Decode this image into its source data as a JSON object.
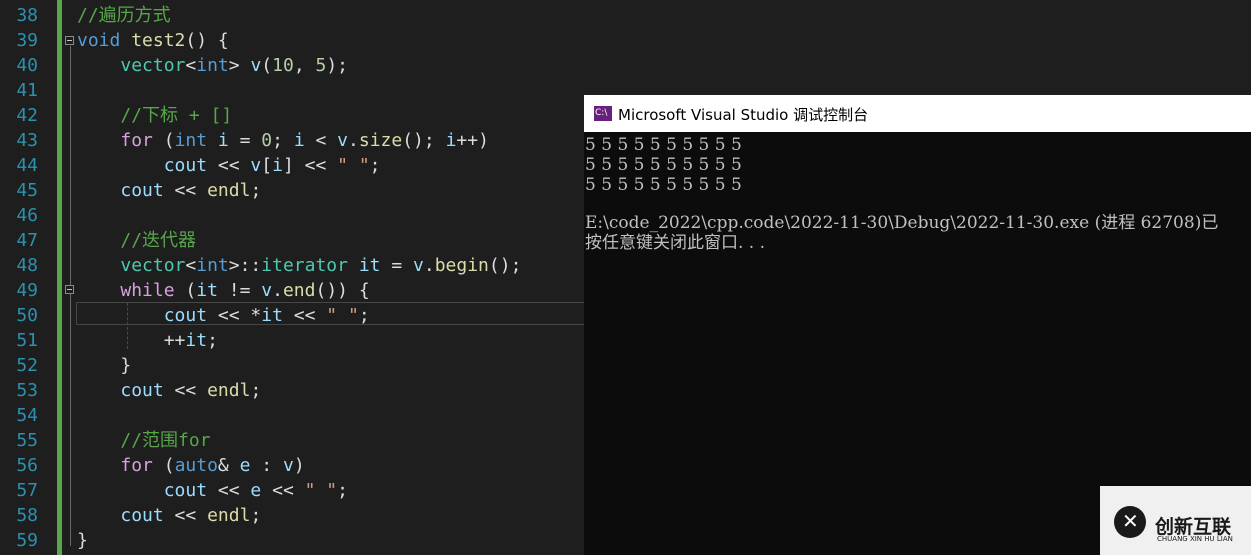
{
  "editor": {
    "lines": [
      {
        "num": "38",
        "tokens": [
          {
            "t": "//遍历方式",
            "c": "cmt"
          }
        ]
      },
      {
        "num": "39",
        "tokens": [
          {
            "t": "void",
            "c": "kw"
          },
          {
            "t": " ",
            "c": "pl"
          },
          {
            "t": "test2",
            "c": "fn"
          },
          {
            "t": "() {",
            "c": "pl"
          }
        ]
      },
      {
        "num": "40",
        "tokens": [
          {
            "t": "    ",
            "c": "pl"
          },
          {
            "t": "vector",
            "c": "typ"
          },
          {
            "t": "<",
            "c": "pl"
          },
          {
            "t": "int",
            "c": "kw"
          },
          {
            "t": "> ",
            "c": "pl"
          },
          {
            "t": "v",
            "c": "var"
          },
          {
            "t": "(",
            "c": "pl"
          },
          {
            "t": "10",
            "c": "num"
          },
          {
            "t": ", ",
            "c": "pl"
          },
          {
            "t": "5",
            "c": "num"
          },
          {
            "t": ");",
            "c": "pl"
          }
        ]
      },
      {
        "num": "41",
        "tokens": []
      },
      {
        "num": "42",
        "tokens": [
          {
            "t": "    ",
            "c": "pl"
          },
          {
            "t": "//下标 + []",
            "c": "cmt"
          }
        ]
      },
      {
        "num": "43",
        "tokens": [
          {
            "t": "    ",
            "c": "pl"
          },
          {
            "t": "for",
            "c": "ctl"
          },
          {
            "t": " (",
            "c": "pl"
          },
          {
            "t": "int",
            "c": "kw"
          },
          {
            "t": " ",
            "c": "pl"
          },
          {
            "t": "i",
            "c": "var"
          },
          {
            "t": " = ",
            "c": "pl"
          },
          {
            "t": "0",
            "c": "num"
          },
          {
            "t": "; ",
            "c": "pl"
          },
          {
            "t": "i",
            "c": "var"
          },
          {
            "t": " < ",
            "c": "pl"
          },
          {
            "t": "v",
            "c": "var"
          },
          {
            "t": ".",
            "c": "pl"
          },
          {
            "t": "size",
            "c": "fn"
          },
          {
            "t": "(); ",
            "c": "pl"
          },
          {
            "t": "i",
            "c": "var"
          },
          {
            "t": "++)",
            "c": "pl"
          }
        ]
      },
      {
        "num": "44",
        "tokens": [
          {
            "t": "        ",
            "c": "pl"
          },
          {
            "t": "cout",
            "c": "var"
          },
          {
            "t": " << ",
            "c": "pl"
          },
          {
            "t": "v",
            "c": "var"
          },
          {
            "t": "[",
            "c": "pl"
          },
          {
            "t": "i",
            "c": "var"
          },
          {
            "t": "] << ",
            "c": "pl"
          },
          {
            "t": "\" \"",
            "c": "str"
          },
          {
            "t": ";",
            "c": "pl"
          }
        ]
      },
      {
        "num": "45",
        "tokens": [
          {
            "t": "    ",
            "c": "pl"
          },
          {
            "t": "cout",
            "c": "var"
          },
          {
            "t": " << ",
            "c": "pl"
          },
          {
            "t": "endl",
            "c": "fn"
          },
          {
            "t": ";",
            "c": "pl"
          }
        ]
      },
      {
        "num": "46",
        "tokens": []
      },
      {
        "num": "47",
        "tokens": [
          {
            "t": "    ",
            "c": "pl"
          },
          {
            "t": "//迭代器",
            "c": "cmt"
          }
        ]
      },
      {
        "num": "48",
        "tokens": [
          {
            "t": "    ",
            "c": "pl"
          },
          {
            "t": "vector",
            "c": "typ"
          },
          {
            "t": "<",
            "c": "pl"
          },
          {
            "t": "int",
            "c": "kw"
          },
          {
            "t": ">::",
            "c": "pl"
          },
          {
            "t": "iterator",
            "c": "typ"
          },
          {
            "t": " ",
            "c": "pl"
          },
          {
            "t": "it",
            "c": "var"
          },
          {
            "t": " = ",
            "c": "pl"
          },
          {
            "t": "v",
            "c": "var"
          },
          {
            "t": ".",
            "c": "pl"
          },
          {
            "t": "begin",
            "c": "fn"
          },
          {
            "t": "();",
            "c": "pl"
          }
        ]
      },
      {
        "num": "49",
        "tokens": [
          {
            "t": "    ",
            "c": "pl"
          },
          {
            "t": "while",
            "c": "ctl"
          },
          {
            "t": " (",
            "c": "pl"
          },
          {
            "t": "it",
            "c": "var"
          },
          {
            "t": " != ",
            "c": "pl"
          },
          {
            "t": "v",
            "c": "var"
          },
          {
            "t": ".",
            "c": "pl"
          },
          {
            "t": "end",
            "c": "fn"
          },
          {
            "t": "()) {",
            "c": "pl"
          }
        ]
      },
      {
        "num": "50",
        "tokens": [
          {
            "t": "        ",
            "c": "pl"
          },
          {
            "t": "cout",
            "c": "var"
          },
          {
            "t": " << *",
            "c": "pl"
          },
          {
            "t": "it",
            "c": "var"
          },
          {
            "t": " << ",
            "c": "pl"
          },
          {
            "t": "\" \"",
            "c": "str"
          },
          {
            "t": ";",
            "c": "pl"
          }
        ]
      },
      {
        "num": "51",
        "tokens": [
          {
            "t": "        ++",
            "c": "pl"
          },
          {
            "t": "it",
            "c": "var"
          },
          {
            "t": ";",
            "c": "pl"
          }
        ]
      },
      {
        "num": "52",
        "tokens": [
          {
            "t": "    }",
            "c": "pl"
          }
        ]
      },
      {
        "num": "53",
        "tokens": [
          {
            "t": "    ",
            "c": "pl"
          },
          {
            "t": "cout",
            "c": "var"
          },
          {
            "t": " << ",
            "c": "pl"
          },
          {
            "t": "endl",
            "c": "fn"
          },
          {
            "t": ";",
            "c": "pl"
          }
        ]
      },
      {
        "num": "54",
        "tokens": []
      },
      {
        "num": "55",
        "tokens": [
          {
            "t": "    ",
            "c": "pl"
          },
          {
            "t": "//范围for",
            "c": "cmt"
          }
        ]
      },
      {
        "num": "56",
        "tokens": [
          {
            "t": "    ",
            "c": "pl"
          },
          {
            "t": "for",
            "c": "ctl"
          },
          {
            "t": " (",
            "c": "pl"
          },
          {
            "t": "auto",
            "c": "kw"
          },
          {
            "t": "& ",
            "c": "pl"
          },
          {
            "t": "e",
            "c": "var"
          },
          {
            "t": " : ",
            "c": "pl"
          },
          {
            "t": "v",
            "c": "var"
          },
          {
            "t": ")",
            "c": "pl"
          }
        ]
      },
      {
        "num": "57",
        "tokens": [
          {
            "t": "        ",
            "c": "pl"
          },
          {
            "t": "cout",
            "c": "var"
          },
          {
            "t": " << ",
            "c": "pl"
          },
          {
            "t": "e",
            "c": "var"
          },
          {
            "t": " << ",
            "c": "pl"
          },
          {
            "t": "\" \"",
            "c": "str"
          },
          {
            "t": ";",
            "c": "pl"
          }
        ]
      },
      {
        "num": "58",
        "tokens": [
          {
            "t": "    ",
            "c": "pl"
          },
          {
            "t": "cout",
            "c": "var"
          },
          {
            "t": " << ",
            "c": "pl"
          },
          {
            "t": "endl",
            "c": "fn"
          },
          {
            "t": ";",
            "c": "pl"
          }
        ]
      },
      {
        "num": "59",
        "tokens": [
          {
            "t": "}",
            "c": "pl"
          }
        ]
      }
    ]
  },
  "console": {
    "title": "Microsoft Visual Studio 调试控制台",
    "icon_text": "C:\\",
    "lines": [
      "5 5 5 5 5 5 5 5 5 5",
      "5 5 5 5 5 5 5 5 5 5",
      "5 5 5 5 5 5 5 5 5 5",
      "",
      "E:\\code_2022\\cpp.code\\2022-11-30\\Debug\\2022-11-30.exe (进程 62708)已",
      "按任意键关闭此窗口. . ."
    ]
  },
  "watermark": {
    "logo_glyph": "✕",
    "name_cn": "创新互联",
    "name_en": "CHUANG XIN HU LIAN"
  }
}
